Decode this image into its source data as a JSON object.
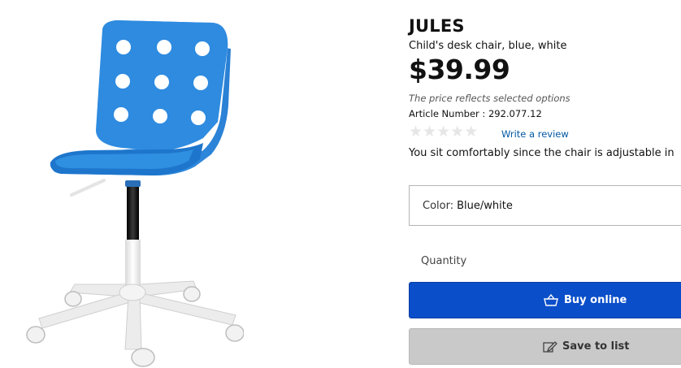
{
  "product": {
    "name": "JULES",
    "description": "Child's desk chair, blue, white",
    "price": "$39.99",
    "price_note": "The price reflects selected options",
    "article_label": "Article Number :",
    "article_number": "292.077.12",
    "rating_stars": 0,
    "write_review": "Write a review",
    "teaser": "You sit comfortably since the chair is adjustable in",
    "chair_colors": {
      "seat": "#2f8fe0",
      "frame": "#f0f0f0",
      "column": "#1a1a1a"
    }
  },
  "options": {
    "color_label": "Color:",
    "color_value": "Blue/white",
    "quantity_label": "Quantity"
  },
  "actions": {
    "buy_label": "Buy online",
    "save_label": "Save to list",
    "buy_color": "#0b4ec9",
    "save_color": "#c9c9c9"
  },
  "icons": {
    "buy": "basket-icon",
    "save": "edit-list-icon",
    "rating": "star-icon"
  }
}
